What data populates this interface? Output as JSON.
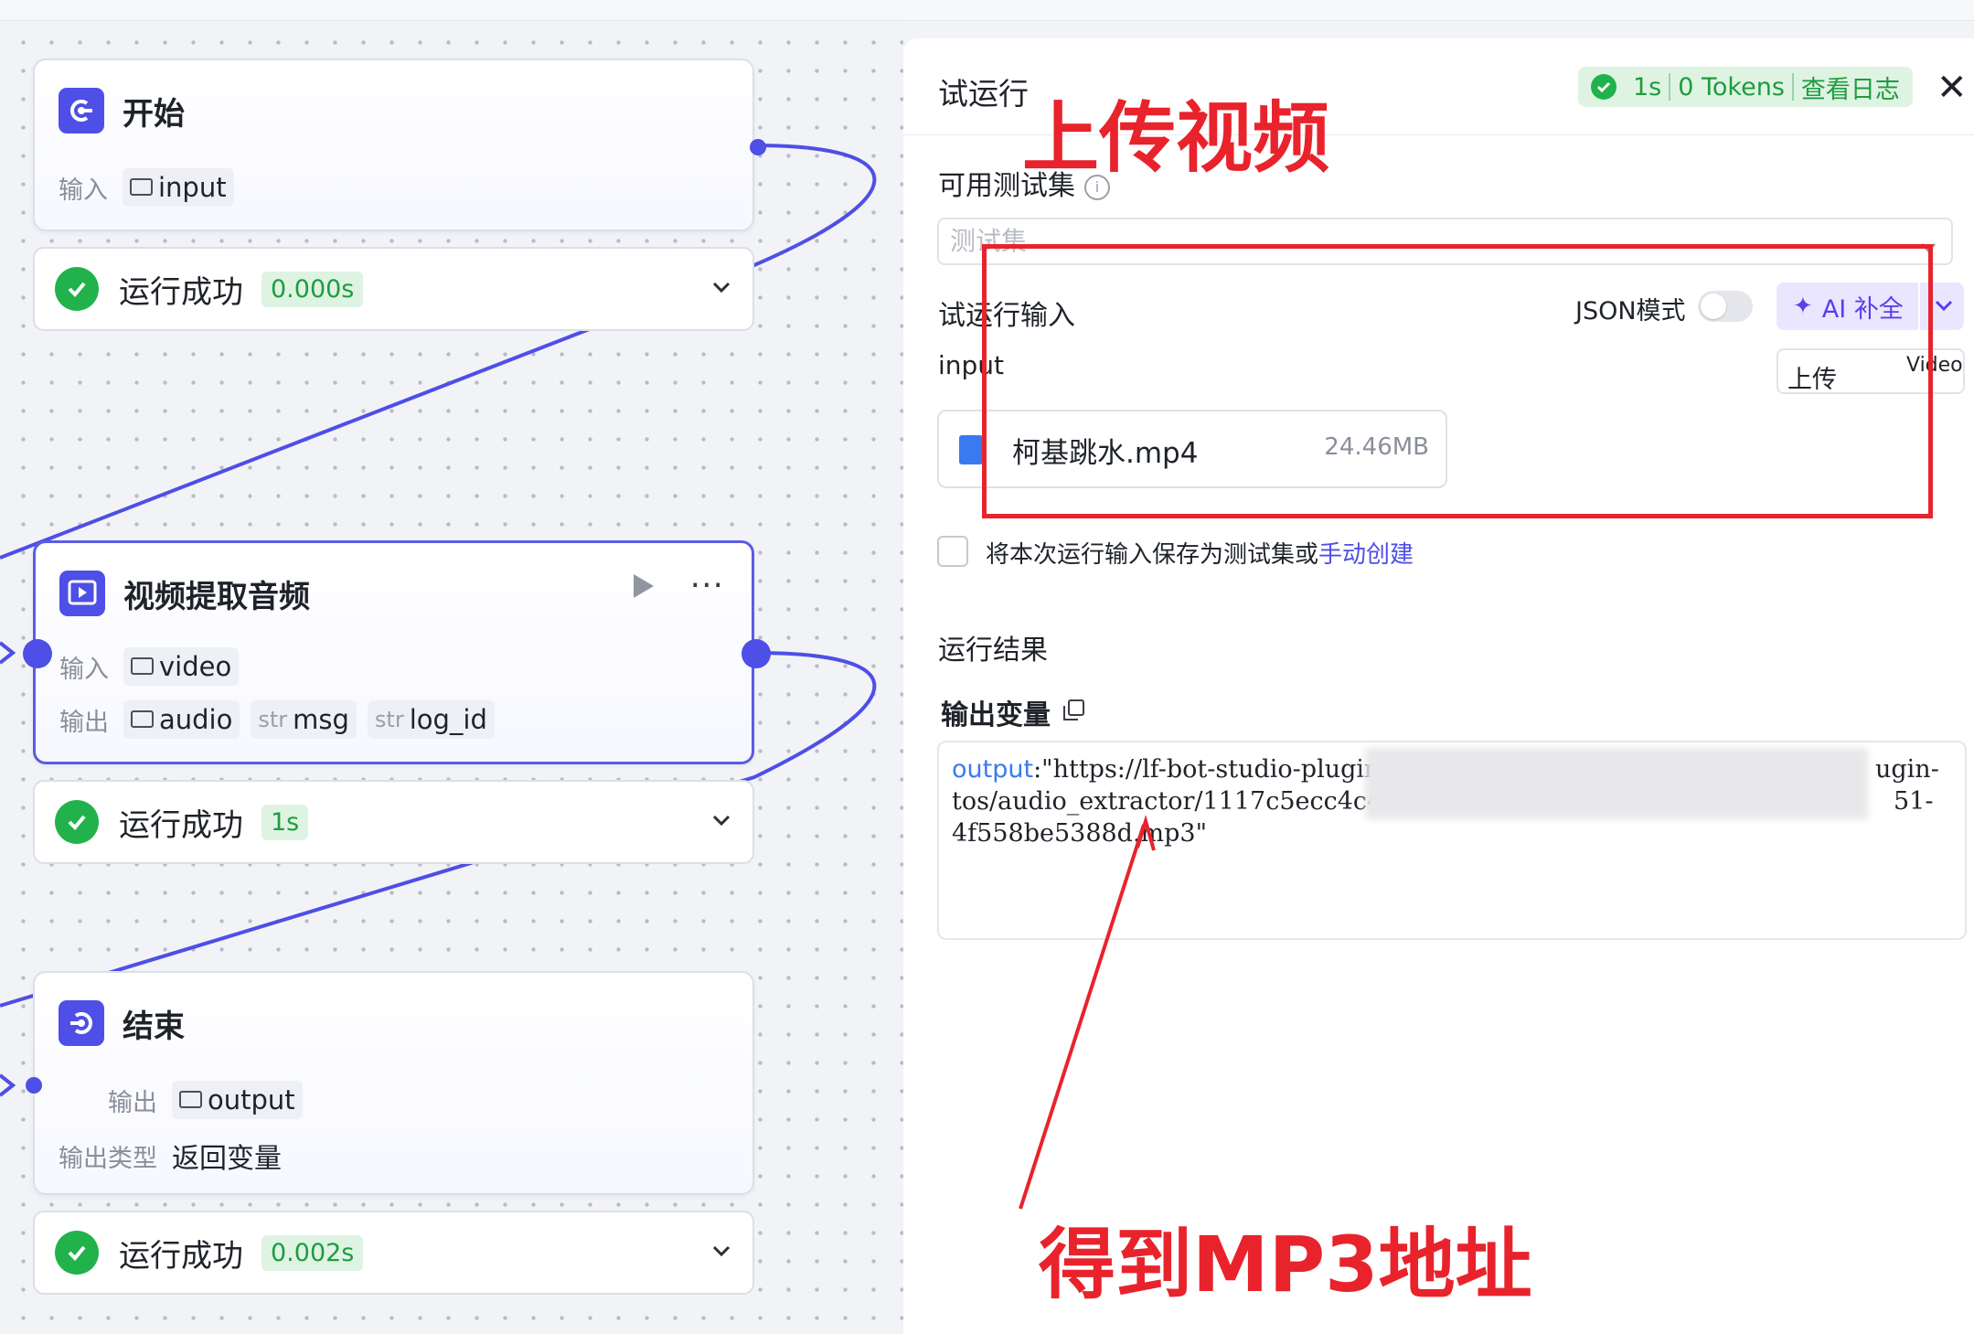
{
  "nodes": {
    "start": {
      "title": "开始",
      "input_label": "输入",
      "input_tag": "input"
    },
    "start_status": {
      "label": "运行成功",
      "time": "0.000s"
    },
    "extract": {
      "title": "视频提取音频",
      "input_label": "输入",
      "input_tag": "video",
      "output_label": "输出",
      "outputs": [
        {
          "type": "",
          "name": "audio"
        },
        {
          "type": "str",
          "name": "msg"
        },
        {
          "type": "str",
          "name": "log_id"
        }
      ]
    },
    "extract_status": {
      "label": "运行成功",
      "time": "1s"
    },
    "end": {
      "title": "结束",
      "output_label": "输出",
      "output_tag": "output",
      "output_type_label": "输出类型",
      "output_type_value": "返回变量"
    },
    "end_status": {
      "label": "运行成功",
      "time": "0.002s"
    }
  },
  "panel": {
    "title": "试运行",
    "badge": {
      "time": "1s",
      "tokens": "0 Tokens",
      "log_link": "查看日志"
    },
    "testset_label": "可用测试集",
    "testset_placeholder": "测试集",
    "input_section_label": "试运行输入",
    "json_mode_label": "JSON模式",
    "ai_button": "AI 补全",
    "input_var": "input",
    "upload_label": "上传",
    "upload_type": "Video",
    "file": {
      "name": "柯基跳水.mp4",
      "size": "24.46MB"
    },
    "save_text": "将本次运行输入保存为测试集或",
    "save_link": "手动创建",
    "result_label": "运行结果",
    "output_var_label": "输出变量",
    "output_key": "output",
    "output_value_1": ":\"https://lf-bot-studio-plugin-",
    "output_value_1b": "ugin-",
    "output_value_2": "tos/audio_extractor/1117c5ecc4c4c2",
    "output_value_2b": "51-",
    "output_value_3": "4f558be5388d.mp3\""
  },
  "annotations": {
    "upload": "上传视频",
    "mp3": "得到MP3地址",
    "color": "#e8232c"
  },
  "colors": {
    "accent": "#4e4fe6",
    "success": "#22b24c"
  }
}
